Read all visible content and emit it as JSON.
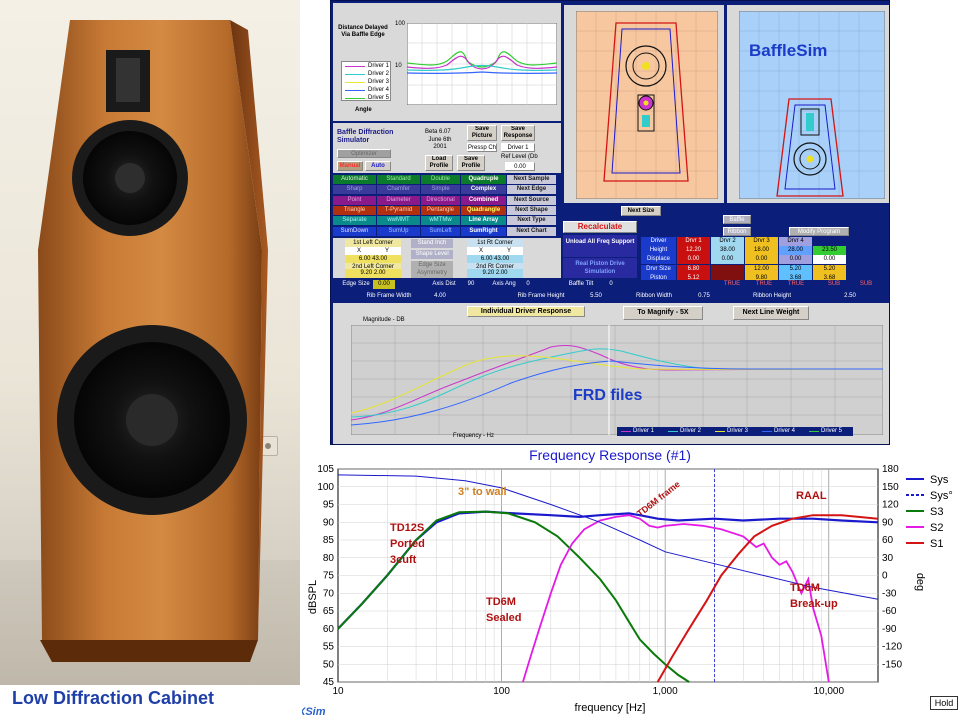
{
  "photo_caption": "Low Diffraction Cabinet",
  "sim": {
    "top_graph": {
      "title": "Distance Delayed Via Baffle Edge",
      "axis_x": "Angle",
      "y_top": "100",
      "y_mid": "10",
      "legend": [
        "Driver 1",
        "Driver 2",
        "Driver 3",
        "Driver 4",
        "Driver 5"
      ]
    },
    "app_title": "Baffle Diffraction Simulator",
    "version": "Beta 6.07",
    "date": "June 6th 2001",
    "buttons": {
      "save_picture": "Save Picture",
      "save_response": "Save Response",
      "optimizer": "Optimizer",
      "manual": "Manual",
      "auto": "Auto",
      "load_profile": "Load Profile",
      "save_profile": "Save Profile",
      "ref_level": "Ref Level (Db",
      "ref_value": "0.00",
      "preset_select": "Pressp Chrt",
      "driver_select": "Driver 1",
      "next_size": "Next Size",
      "recalculate": "Recalculate",
      "unload_all": "Unload All Freq Support",
      "real_piston": "Real Piston Drive Simulation",
      "baffle": "Baffle",
      "ribbon": "Ribbon",
      "modify_program": "Modify Program",
      "individual_driver": "Individual Driver Response",
      "to_magnify": "To Magnify - 5X",
      "next_line_weight": "Next Line Weight"
    },
    "mode_grid": [
      [
        "Automatic",
        "Standard",
        "Double",
        "Quadruple",
        "Next Sample"
      ],
      [
        "Sharp",
        "Chamfer",
        "Simple",
        "Complex",
        "Next Edge"
      ],
      [
        "Point",
        "Diameter",
        "Directional",
        "Combined",
        "Next Source"
      ],
      [
        "Triangle",
        "T-Pyramid",
        "Pentangle",
        "Quadrangle",
        "Next Shape"
      ],
      [
        "Separate",
        "wwMMT",
        "wMTMw",
        "Line Array",
        "Next Type"
      ],
      [
        "SumDown",
        "SumUp",
        "SumLeft",
        "SumRight",
        "Next Chart"
      ]
    ],
    "corners": {
      "first_left": "1st Left Corner",
      "first_right": "1st Rt Corner",
      "second_left": "2nd Left Corner",
      "second_right": "2nd Rt Corner",
      "x": "X",
      "y": "Y",
      "fl_vals": "6.00 43.00",
      "fr_vals": "6.00 43.00",
      "sl_vals": "9.20 2.00",
      "sr_vals": "9.20 2.00",
      "stand_inch": "Stand Inch",
      "shape_level": "Shape Level",
      "edge_size": "Edge Size",
      "asymmetry": "Asymmetry"
    },
    "driver_table": {
      "rows": [
        [
          "Driver",
          "Drvr 1",
          "Drvr 2",
          "Drvr 3",
          "Drvr 4"
        ],
        [
          "Height",
          "12.20",
          "38.00",
          "18.00",
          "28.00",
          "23.50"
        ],
        [
          "Displace",
          "0.00",
          "0.00",
          "0.00",
          "0.00",
          "0.00"
        ],
        [
          "Drvr Size",
          "6.80",
          "",
          "12.00",
          "5.20",
          "5.20"
        ],
        [
          "Piston",
          "5.12",
          "",
          "9.80",
          "3.68",
          "3.68"
        ]
      ]
    },
    "status_row": {
      "edge_size": "Edge Size",
      "edge_val": "0.00",
      "axis_dist": "Axis Dist",
      "axis_dist_val": "90",
      "axis_ang": "Axis Ang",
      "axis_ang_val": "0",
      "baffle_tilt": "Baffle Tilt",
      "baffle_tilt_val": "0",
      "checks": [
        "TRUE",
        "TRUE",
        "TRUE",
        "SUB",
        "SUB"
      ]
    },
    "frame_row": {
      "rib_frame_width": "Rib Frame Width",
      "rib_frame_width_val": "4.00",
      "rib_frame_height": "Rib Frame Height",
      "rib_frame_height_val": "5.50",
      "ribbon_width": "Ribbon Width",
      "ribbon_width_val": "0.75",
      "ribbon_height": "Ribbon Height",
      "ribbon_height_val": "2.50"
    },
    "bafflesim_label": "BaffleSim",
    "frd_label": "FRD files",
    "magnitude_label": "Magnitude - DB",
    "frequency_label": "Frequency - Hz",
    "lower_legend": [
      "Driver 1",
      "Driver 2",
      "Driver 3",
      "Driver 4",
      "Driver 5"
    ],
    "colors": {
      "window_bg": "#0b1e7a",
      "driver1": "#cc33cc",
      "driver2": "#33cccc",
      "driver3": "#e6e633",
      "driver4": "#3366ff",
      "driver5": "#33cc33"
    }
  },
  "xsim": {
    "brand": "XSim",
    "hold": "Hold",
    "annotations": {
      "wall": "3\" to wall",
      "td12s": "TD12S",
      "td12s_2": "Ported",
      "td12s_3": "3cuft",
      "td6m_sealed": "TD6M",
      "td6m_sealed_2": "Sealed",
      "td6m_frame": "TD6M frame",
      "raal": "RAAL",
      "td6m_breakup": "TD6M",
      "td6m_breakup_2": "Break-up"
    }
  },
  "chart_data": {
    "type": "line",
    "title": "Frequency Response (#1)",
    "xlabel": "frequency [Hz]",
    "ylabel": "dBSPL",
    "y2label": "deg",
    "xscale": "log",
    "xlim": [
      10,
      20000
    ],
    "ylim": [
      45,
      105
    ],
    "y2lim": [
      -180,
      180
    ],
    "x_ticks": [
      "10",
      "100",
      "1,000",
      "10,000"
    ],
    "y_ticks": [
      45,
      50,
      55,
      60,
      65,
      70,
      75,
      80,
      85,
      90,
      95,
      100,
      105
    ],
    "y2_ticks": [
      -150,
      -120,
      -90,
      -60,
      -30,
      0,
      30,
      60,
      90,
      120,
      150,
      180
    ],
    "legend": [
      {
        "name": "Sys",
        "color": "#1a1acc",
        "style": "solid"
      },
      {
        "name": "Sys°",
        "color": "#1a1acc",
        "style": "dashed"
      },
      {
        "name": "S3",
        "color": "#0a7a0a",
        "style": "solid"
      },
      {
        "name": "S2",
        "color": "#e61ae6",
        "style": "solid"
      },
      {
        "name": "S1",
        "color": "#d41414",
        "style": "solid"
      }
    ],
    "series": [
      {
        "name": "Sys",
        "color": "#1a1acc",
        "width": 2.2,
        "points": [
          [
            10,
            60
          ],
          [
            14,
            67
          ],
          [
            20,
            75
          ],
          [
            30,
            85
          ],
          [
            40,
            90
          ],
          [
            55,
            92.5
          ],
          [
            80,
            93
          ],
          [
            120,
            92.5
          ],
          [
            200,
            92
          ],
          [
            300,
            91.5
          ],
          [
            400,
            92
          ],
          [
            600,
            92.5
          ],
          [
            700,
            92
          ],
          [
            900,
            91
          ],
          [
            1200,
            90.5
          ],
          [
            2000,
            91
          ],
          [
            3000,
            90.5
          ],
          [
            5000,
            91
          ],
          [
            8000,
            91
          ],
          [
            12000,
            90.5
          ],
          [
            20000,
            90
          ]
        ]
      },
      {
        "name": "S3",
        "color": "#0a7a0a",
        "width": 2,
        "points": [
          [
            10,
            60
          ],
          [
            14,
            67
          ],
          [
            20,
            75
          ],
          [
            30,
            85
          ],
          [
            40,
            90.5
          ],
          [
            55,
            92.8
          ],
          [
            80,
            93
          ],
          [
            110,
            92.5
          ],
          [
            160,
            90
          ],
          [
            220,
            86
          ],
          [
            300,
            80
          ],
          [
            400,
            74
          ],
          [
            500,
            68
          ],
          [
            600,
            62
          ],
          [
            700,
            57
          ],
          [
            850,
            53
          ],
          [
            1000,
            50
          ],
          [
            1200,
            47
          ],
          [
            1400,
            45
          ]
        ]
      },
      {
        "name": "S2",
        "color": "#e61ae6",
        "width": 1.8,
        "points": [
          [
            135,
            45
          ],
          [
            150,
            52
          ],
          [
            170,
            60
          ],
          [
            200,
            70
          ],
          [
            230,
            78
          ],
          [
            270,
            84
          ],
          [
            320,
            88
          ],
          [
            400,
            90.5
          ],
          [
            500,
            91.5
          ],
          [
            600,
            92
          ],
          [
            700,
            91
          ],
          [
            800,
            89
          ],
          [
            900,
            88.5
          ],
          [
            1000,
            89
          ],
          [
            1300,
            89.5
          ],
          [
            1700,
            89
          ],
          [
            2200,
            88
          ],
          [
            3000,
            86
          ],
          [
            3600,
            83
          ],
          [
            4000,
            84
          ],
          [
            4500,
            80
          ],
          [
            5000,
            78
          ],
          [
            5500,
            79
          ],
          [
            6000,
            76
          ],
          [
            6800,
            70
          ],
          [
            7500,
            74
          ],
          [
            8000,
            66
          ],
          [
            9000,
            58
          ],
          [
            10000,
            45
          ]
        ]
      },
      {
        "name": "S1",
        "color": "#d41414",
        "width": 2,
        "points": [
          [
            900,
            45
          ],
          [
            1100,
            52
          ],
          [
            1400,
            60
          ],
          [
            1800,
            68
          ],
          [
            2200,
            75
          ],
          [
            2800,
            81
          ],
          [
            3500,
            86
          ],
          [
            4500,
            89
          ],
          [
            6000,
            91
          ],
          [
            8000,
            92
          ],
          [
            12000,
            92
          ],
          [
            20000,
            91
          ]
        ]
      },
      {
        "name": "Sys°",
        "color": "#1a1acc",
        "width": 1,
        "axis": "phase",
        "points": [
          [
            10,
            170
          ],
          [
            30,
            168
          ],
          [
            60,
            160
          ],
          [
            100,
            148
          ],
          [
            200,
            120
          ],
          [
            400,
            90
          ],
          [
            700,
            60
          ],
          [
            1000,
            40
          ],
          [
            2000,
            20
          ],
          [
            4000,
            0
          ],
          [
            8000,
            -20
          ],
          [
            20000,
            -40
          ]
        ]
      }
    ]
  }
}
